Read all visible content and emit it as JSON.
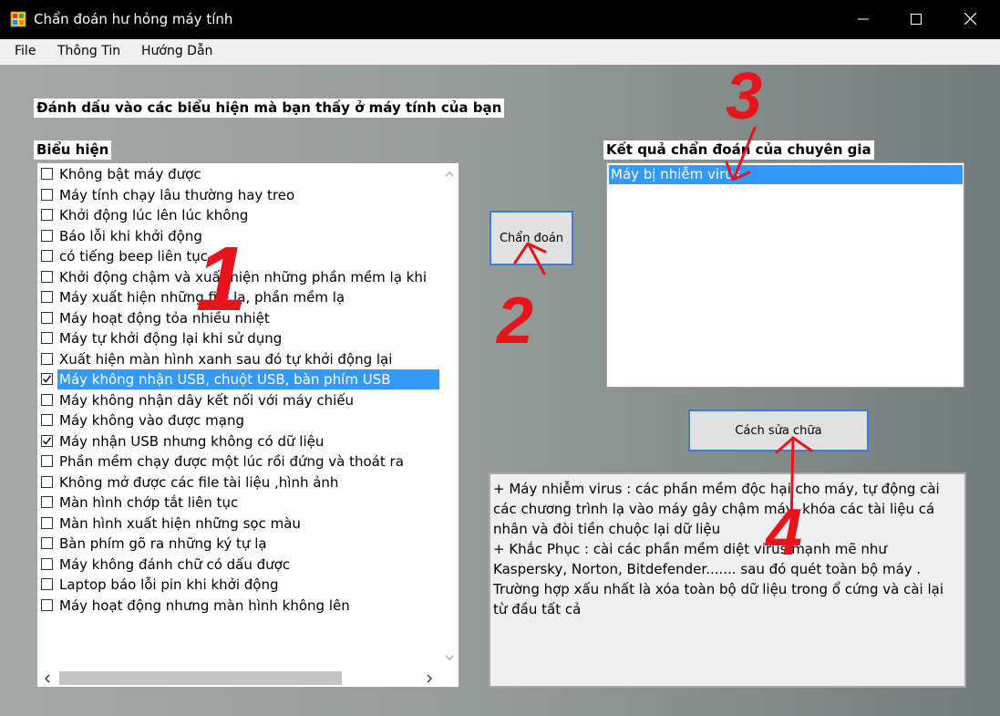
{
  "window": {
    "title": "Chẩn đoán hư hỏng máy tính",
    "accent": "#3399ff"
  },
  "menu": {
    "items": [
      "File",
      "Thông Tin",
      "Hướng Dẫn"
    ]
  },
  "instruction": "Đánh dấu vào các biểu hiện mà bạn thấy ở máy tính của bạn",
  "symptoms": {
    "header": "Biểu hiện",
    "items": [
      {
        "label": "Không bật máy được",
        "checked": false,
        "selected": false
      },
      {
        "label": "Máy tính chạy lâu thường hay treo",
        "checked": false,
        "selected": false
      },
      {
        "label": "Khởi động lúc lên lúc không",
        "checked": false,
        "selected": false
      },
      {
        "label": "Báo lỗi khi khởi động",
        "checked": false,
        "selected": false
      },
      {
        "label": "có tiếng beep liên tục",
        "checked": false,
        "selected": false
      },
      {
        "label": "Khởi động chậm và xuất hiện những phần mềm lạ khi",
        "checked": false,
        "selected": false
      },
      {
        "label": "Máy xuất hiện những file lạ, phần mềm lạ",
        "checked": false,
        "selected": false
      },
      {
        "label": "Máy hoạt động tỏa nhiều nhiệt",
        "checked": false,
        "selected": false
      },
      {
        "label": "Máy tự khởi động lại khi sử dụng",
        "checked": false,
        "selected": false
      },
      {
        "label": "Xuất hiện màn hình xanh sau đó tự khởi động lại",
        "checked": false,
        "selected": false
      },
      {
        "label": "Máy không nhận USB, chuột USB, bàn phím USB",
        "checked": true,
        "selected": true
      },
      {
        "label": "Máy không nhận dây kết nối với máy chiếu",
        "checked": false,
        "selected": false
      },
      {
        "label": "Máy không vào được mạng",
        "checked": false,
        "selected": false
      },
      {
        "label": "Máy nhận USB nhưng không có dữ liệu",
        "checked": true,
        "selected": false
      },
      {
        "label": "Phần mềm chạy được một lúc rồi đứng và thoát ra",
        "checked": false,
        "selected": false
      },
      {
        "label": "Không mở được các file tài liệu ,hình ảnh",
        "checked": false,
        "selected": false
      },
      {
        "label": "Màn hình chớp tắt liên tục",
        "checked": false,
        "selected": false
      },
      {
        "label": "Màn hình xuất hiện những sọc màu",
        "checked": false,
        "selected": false
      },
      {
        "label": "Bàn phím gõ ra những ký tự lạ",
        "checked": false,
        "selected": false
      },
      {
        "label": "Máy không đánh chữ có dấu được",
        "checked": false,
        "selected": false
      },
      {
        "label": "Laptop báo lỗi pin khi khởi động",
        "checked": false,
        "selected": false
      },
      {
        "label": "Máy hoạt động nhưng màn hình không lên",
        "checked": false,
        "selected": false
      }
    ]
  },
  "diagnose_button": "Chẩn đoán",
  "results": {
    "header": "Kết quả chẩn đoán của chuyên gia",
    "items": [
      "Máy bị nhiễm virus"
    ]
  },
  "repair_button": "Cách sửa chữa",
  "repair_text": "+ Máy nhiễm virus : các phần mềm độc hại cho máy, tự động cài các chương trình lạ vào máy gây chậm máy, khóa các tài liệu cá nhân và đòi tiền chuộc lại dữ liệu\n+ Khắc Phục : cài các phần mềm diệt virus mạnh mẽ như Kaspersky, Norton, Bitdefender....... sau đó quét toàn bộ máy . Trường hợp xấu nhất là xóa toàn bộ dữ liệu trong ổ cứng và cài lại từ đầu tất cả",
  "annotations": {
    "color": "#e8141b",
    "labels": [
      "1",
      "2",
      "3",
      "4"
    ]
  }
}
